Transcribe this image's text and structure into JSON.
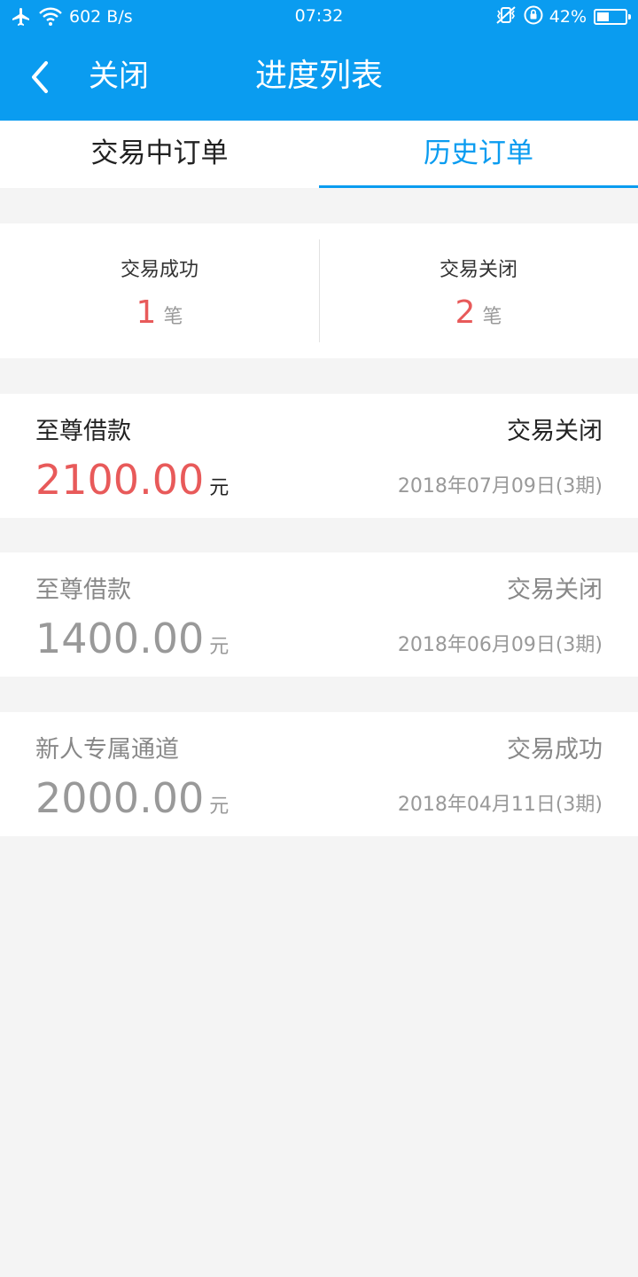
{
  "status_bar": {
    "speed": "602 B/s",
    "time": "07:32",
    "battery_pct": "42%",
    "battery_level": 0.42,
    "icons": [
      "airplane-icon",
      "wifi-icon",
      "vibrate-icon",
      "rotation-lock-icon",
      "battery-icon"
    ]
  },
  "nav": {
    "close_label": "关闭",
    "title": "进度列表",
    "back_icon": "chevron-left-icon"
  },
  "tabs": [
    {
      "label": "交易中订单",
      "active": false
    },
    {
      "label": "历史订单",
      "active": true
    }
  ],
  "summary": [
    {
      "label": "交易成功",
      "count": "1",
      "unit": "笔"
    },
    {
      "label": "交易关闭",
      "count": "2",
      "unit": "笔"
    }
  ],
  "orders": [
    {
      "name": "至尊借款",
      "status": "交易关闭",
      "amount": "2100.00",
      "unit": "元",
      "date": "2018年07月09日(3期)"
    },
    {
      "name": "至尊借款",
      "status": "交易关闭",
      "amount": "1400.00",
      "unit": "元",
      "date": "2018年06月09日(3期)"
    },
    {
      "name": "新人专属通道",
      "status": "交易成功",
      "amount": "2000.00",
      "unit": "元",
      "date": "2018年04月11日(3期)"
    }
  ],
  "colors": {
    "primary": "#0a9cf0",
    "highlight": "#e85a5a",
    "background": "#f4f4f4"
  }
}
